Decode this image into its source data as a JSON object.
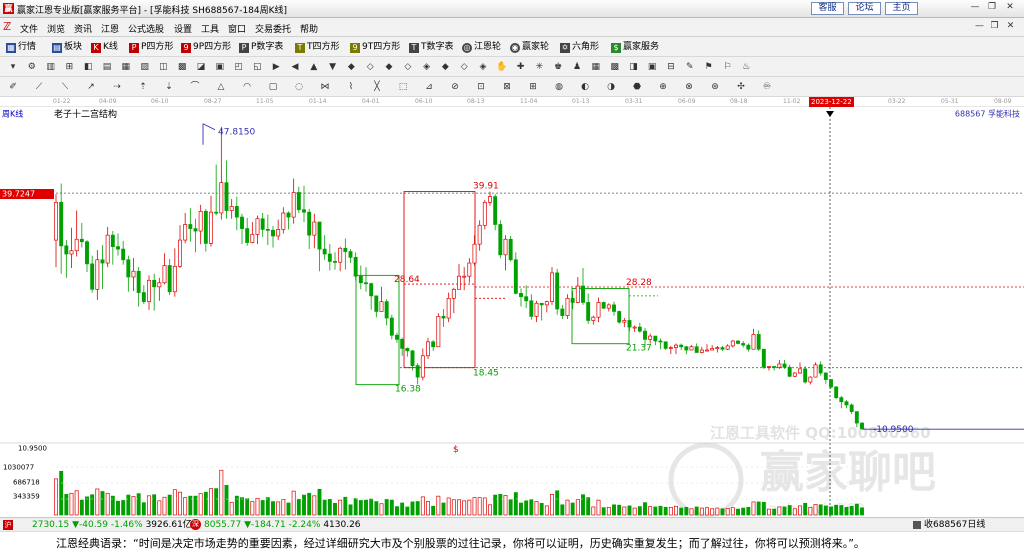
{
  "window": {
    "title": "赢家江恩专业版[赢家服务平台] - [孚能科技  SH688567-184周K线]",
    "links": [
      "客服",
      "论坛",
      "主页"
    ]
  },
  "menu": {
    "items": [
      "文件",
      "浏览",
      "资讯",
      "江恩",
      "公式选股",
      "设置",
      "工具",
      "窗口",
      "交易委托",
      "帮助"
    ]
  },
  "toolbar": {
    "items": [
      {
        "label": "行情",
        "icon": "grid-icon",
        "color": "#2a4d9a"
      },
      {
        "label": "板块",
        "icon": "blocks-icon",
        "color": "#2a4d9a"
      },
      {
        "label": "K线",
        "icon": "candlestick-icon",
        "color": "#c00000"
      },
      {
        "label": "P四方形",
        "icon": "square-p-icon",
        "color": "#c00000"
      },
      {
        "label": "9P四方形",
        "icon": "square-9p-icon",
        "color": "#c00000"
      },
      {
        "label": "P数字表",
        "icon": "table-p-icon",
        "color": "#333333"
      },
      {
        "label": "T四方形",
        "icon": "square-t-icon",
        "color": "#7a7a00"
      },
      {
        "label": "9T四方形",
        "icon": "square-9t-icon",
        "color": "#7a7a00"
      },
      {
        "label": "T数字表",
        "icon": "table-t-icon",
        "color": "#333333"
      },
      {
        "label": "江恩轮",
        "icon": "gann-wheel-icon",
        "color": "#333333"
      },
      {
        "label": "赢家轮",
        "icon": "winner-wheel-icon",
        "color": "#333333"
      },
      {
        "label": "六角形",
        "icon": "hexagon-icon",
        "color": "#333333"
      },
      {
        "label": "赢家服务",
        "icon": "dollar-icon",
        "color": "#2a8a2a"
      }
    ]
  },
  "date_axis": {
    "labels": [
      "01-22",
      "04-09",
      "06-10",
      "08-27",
      "11-05",
      "01-14",
      "04-01",
      "06-10",
      "08-13",
      "11-04",
      "01-13",
      "03-31",
      "06-09",
      "08-18",
      "11-02",
      "03-22",
      "05-31",
      "08-09"
    ],
    "selected": "2023-12-22"
  },
  "chart": {
    "period_label": "周K线",
    "structure_label": "老子十二宫结构",
    "stock_label": "688567 孚能科技",
    "price_tag": "39.7247",
    "annotations": {
      "high": "47.8150",
      "box_top": "39.91",
      "box_mid": "28.64",
      "box_low": "18.45",
      "left_low": "16.38",
      "right_mid": "28.28",
      "right_low": "21.37",
      "last_low": "-10.9500",
      "marker": "$"
    },
    "watermark": {
      "line1": "江恩工具软件  QQ:100800360",
      "line2": "赢家聊吧",
      "line3": "liaoba.win360"
    },
    "colors": {
      "up": "#e00000",
      "down": "#00a000",
      "box_red": "#e00000",
      "box_green": "#00a000",
      "blue": "#3030b0"
    }
  },
  "volume": {
    "labels": [
      "10.9500",
      "1030077",
      "686718",
      "343359"
    ]
  },
  "chart_data": {
    "type": "candlestick",
    "title": "老子十二宫结构",
    "series_name": "688567 孚能科技 周K线",
    "ylim": [
      10,
      49
    ],
    "key_levels": [
      47.815,
      39.91,
      39.7247,
      28.64,
      28.28,
      21.37,
      18.45,
      16.38,
      10.95
    ],
    "candles": [
      [
        34.0,
        38.6,
        39.6,
        30.7
      ],
      [
        38.6,
        33.3,
        40.9,
        29.9
      ],
      [
        33.3,
        32.3,
        34.0,
        29.4
      ],
      [
        32.3,
        32.7,
        35.5,
        30.6
      ],
      [
        32.7,
        34.1,
        37.6,
        32.0
      ],
      [
        34.1,
        33.8,
        36.1,
        33.1
      ],
      [
        33.8,
        31.1,
        34.0,
        30.1
      ],
      [
        31.1,
        28.0,
        32.1,
        27.6
      ],
      [
        28.0,
        31.6,
        32.8,
        26.7
      ],
      [
        31.6,
        31.2,
        33.4,
        28.0
      ],
      [
        31.2,
        34.6,
        35.6,
        30.7
      ],
      [
        34.6,
        33.2,
        35.1,
        31.0
      ],
      [
        33.2,
        32.9,
        34.8,
        32.1
      ],
      [
        32.9,
        31.6,
        33.9,
        31.0
      ],
      [
        31.6,
        29.5,
        32.1,
        27.7
      ],
      [
        29.5,
        30.2,
        31.8,
        27.8
      ],
      [
        30.2,
        27.6,
        30.7,
        25.9
      ],
      [
        27.6,
        26.5,
        28.5,
        26.2
      ],
      [
        26.5,
        29.1,
        29.7,
        25.5
      ],
      [
        29.1,
        28.3,
        29.9,
        25.4
      ],
      [
        28.3,
        28.8,
        29.4,
        26.6
      ],
      [
        28.8,
        30.9,
        32.4,
        28.6
      ],
      [
        30.9,
        27.7,
        31.7,
        27.3
      ],
      [
        27.7,
        30.8,
        33.0,
        27.1
      ],
      [
        30.8,
        34.0,
        35.8,
        30.6
      ],
      [
        34.0,
        35.9,
        37.3,
        33.6
      ],
      [
        35.9,
        35.4,
        37.9,
        33.8
      ],
      [
        35.4,
        35.1,
        36.6,
        32.5
      ],
      [
        35.1,
        37.5,
        38.3,
        33.5
      ],
      [
        37.5,
        33.6,
        37.8,
        32.6
      ],
      [
        33.6,
        37.4,
        39.4,
        33.2
      ],
      [
        37.4,
        37.3,
        43.2,
        37.0
      ],
      [
        37.3,
        41.0,
        47.8,
        36.5
      ],
      [
        41.0,
        37.6,
        43.7,
        36.6
      ],
      [
        37.6,
        38.1,
        39.0,
        36.6
      ],
      [
        38.1,
        36.8,
        39.3,
        35.2
      ],
      [
        36.8,
        35.4,
        37.2,
        33.5
      ],
      [
        35.4,
        33.7,
        36.7,
        33.3
      ],
      [
        33.7,
        34.7,
        36.2,
        33.6
      ],
      [
        34.7,
        36.6,
        37.0,
        33.5
      ],
      [
        36.6,
        35.3,
        37.3,
        34.4
      ],
      [
        35.3,
        35.2,
        37.1,
        33.4
      ],
      [
        35.2,
        34.5,
        35.7,
        33.1
      ],
      [
        34.5,
        35.3,
        36.5,
        34.0
      ],
      [
        35.3,
        37.3,
        38.0,
        34.8
      ],
      [
        37.3,
        36.8,
        37.5,
        35.3
      ],
      [
        36.8,
        39.8,
        41.5,
        36.0
      ],
      [
        39.8,
        37.7,
        40.5,
        37.3
      ],
      [
        37.7,
        37.4,
        40.6,
        36.2
      ],
      [
        37.4,
        34.6,
        37.8,
        32.9
      ],
      [
        34.6,
        36.2,
        37.2,
        33.0
      ],
      [
        36.2,
        32.9,
        36.2,
        30.2
      ],
      [
        32.9,
        32.3,
        34.6,
        31.6
      ],
      [
        32.3,
        31.4,
        33.5,
        30.3
      ],
      [
        31.4,
        31.3,
        32.5,
        30.4
      ],
      [
        31.3,
        33.0,
        33.2,
        30.2
      ],
      [
        33.0,
        32.6,
        34.2,
        30.4
      ],
      [
        32.6,
        31.9,
        32.9,
        31.2
      ],
      [
        31.9,
        29.6,
        32.5,
        29.1
      ],
      [
        29.6,
        28.8,
        30.9,
        28.0
      ],
      [
        28.8,
        28.7,
        30.7,
        27.7
      ],
      [
        28.7,
        27.2,
        28.8,
        25.5
      ],
      [
        27.2,
        25.3,
        27.2,
        24.6
      ],
      [
        25.3,
        26.5,
        28.3,
        26.3
      ],
      [
        26.5,
        24.5,
        26.8,
        23.6
      ],
      [
        24.5,
        22.4,
        24.9,
        21.9
      ],
      [
        22.4,
        21.9,
        22.7,
        21.5
      ],
      [
        21.9,
        20.8,
        22.1,
        19.9
      ],
      [
        20.8,
        20.5,
        20.9,
        19.8
      ],
      [
        20.5,
        18.7,
        20.6,
        18.1
      ],
      [
        18.7,
        17.3,
        19.0,
        16.4
      ],
      [
        17.3,
        19.9,
        20.8,
        16.9
      ],
      [
        19.9,
        21.6,
        22.1,
        19.5
      ],
      [
        21.6,
        21.0,
        21.8,
        20.5
      ],
      [
        21.0,
        24.7,
        25.1,
        21.0
      ],
      [
        24.7,
        24.5,
        25.6,
        23.4
      ],
      [
        24.5,
        26.9,
        27.6,
        24.0
      ],
      [
        26.9,
        28.0,
        28.2,
        25.1
      ],
      [
        28.0,
        29.6,
        31.1,
        28.0
      ],
      [
        29.6,
        29.6,
        30.7,
        27.9
      ],
      [
        29.6,
        31.2,
        31.8,
        28.8
      ],
      [
        31.2,
        33.5,
        34.6,
        30.9
      ],
      [
        33.5,
        35.8,
        36.4,
        32.7
      ],
      [
        35.8,
        38.6,
        38.9,
        35.3
      ],
      [
        38.6,
        39.3,
        39.9,
        38.2
      ],
      [
        39.3,
        35.9,
        39.6,
        35.2
      ],
      [
        35.9,
        32.2,
        36.4,
        31.8
      ],
      [
        32.2,
        34.1,
        34.6,
        30.3
      ],
      [
        34.1,
        31.6,
        34.5,
        31.4
      ],
      [
        31.6,
        27.5,
        32.5,
        27.4
      ],
      [
        27.5,
        27.1,
        28.1,
        25.9
      ],
      [
        27.1,
        26.6,
        28.5,
        25.7
      ],
      [
        26.6,
        24.7,
        27.4,
        24.3
      ],
      [
        24.7,
        26.3,
        26.6,
        24.0
      ],
      [
        26.3,
        26.1,
        26.3,
        24.2
      ],
      [
        26.1,
        26.5,
        26.6,
        25.2
      ],
      [
        26.5,
        30.0,
        30.7,
        26.1
      ],
      [
        30.0,
        25.6,
        30.5,
        24.9
      ],
      [
        25.6,
        24.8,
        26.1,
        24.4
      ],
      [
        24.8,
        26.9,
        27.4,
        24.4
      ],
      [
        26.9,
        26.4,
        27.8,
        25.6
      ],
      [
        26.4,
        28.4,
        29.5,
        26.3
      ],
      [
        28.4,
        26.4,
        30.6,
        26.1
      ],
      [
        26.4,
        24.2,
        27.5,
        23.8
      ],
      [
        24.2,
        24.6,
        24.8,
        23.7
      ],
      [
        24.6,
        26.4,
        27.0,
        24.0
      ],
      [
        26.4,
        25.7,
        26.5,
        25.6
      ],
      [
        25.7,
        26.1,
        26.3,
        25.3
      ],
      [
        26.1,
        25.3,
        26.5,
        24.8
      ],
      [
        25.3,
        24.0,
        25.4,
        23.8
      ],
      [
        24.0,
        24.2,
        24.5,
        23.4
      ],
      [
        24.2,
        23.4,
        24.3,
        22.9
      ],
      [
        23.4,
        23.4,
        23.6,
        22.8
      ],
      [
        23.4,
        22.9,
        23.9,
        22.7
      ],
      [
        22.9,
        21.9,
        23.3,
        21.0
      ],
      [
        21.9,
        22.3,
        22.6,
        21.4
      ],
      [
        22.3,
        21.7,
        22.3,
        21.2
      ],
      [
        21.7,
        21.6,
        22.0,
        20.7
      ],
      [
        21.6,
        20.8,
        21.6,
        20.6
      ],
      [
        20.8,
        20.9,
        21.1,
        20.1
      ],
      [
        20.9,
        21.2,
        21.4,
        20.1
      ],
      [
        21.2,
        21.0,
        21.4,
        20.6
      ],
      [
        21.0,
        20.6,
        21.1,
        20.1
      ],
      [
        20.6,
        21.0,
        21.2,
        20.6
      ],
      [
        21.0,
        20.3,
        21.4,
        20.3
      ],
      [
        20.3,
        20.6,
        21.0,
        20.2
      ],
      [
        20.6,
        20.6,
        21.3,
        20.4
      ],
      [
        20.6,
        20.8,
        21.2,
        20.6
      ],
      [
        20.8,
        20.9,
        21.1,
        20.3
      ],
      [
        20.9,
        20.7,
        21.1,
        20.5
      ],
      [
        20.7,
        21.1,
        21.3,
        20.6
      ],
      [
        21.1,
        21.7,
        21.8,
        20.9
      ],
      [
        21.7,
        21.4,
        21.8,
        21.3
      ],
      [
        21.4,
        21.2,
        21.7,
        20.9
      ],
      [
        21.2,
        20.7,
        21.4,
        20.4
      ],
      [
        20.7,
        22.5,
        23.2,
        20.7
      ],
      [
        22.5,
        20.7,
        23.0,
        20.5
      ],
      [
        20.7,
        18.5,
        20.7,
        18.3
      ],
      [
        18.5,
        18.6,
        18.6,
        18.1
      ],
      [
        18.6,
        18.5,
        18.6,
        18.1
      ],
      [
        18.5,
        18.9,
        19.4,
        18.3
      ],
      [
        18.9,
        18.5,
        19.4,
        18.3
      ],
      [
        18.5,
        17.4,
        18.8,
        17.3
      ],
      [
        17.4,
        17.8,
        17.9,
        17.3
      ],
      [
        17.8,
        18.3,
        19.1,
        17.7
      ],
      [
        18.3,
        16.7,
        18.6,
        16.5
      ],
      [
        16.7,
        17.3,
        17.4,
        16.4
      ],
      [
        17.3,
        18.8,
        19.1,
        17.3
      ],
      [
        18.8,
        17.8,
        19.2,
        17.5
      ],
      [
        17.8,
        17.0,
        17.9,
        16.5
      ],
      [
        17.0,
        16.1,
        17.0,
        15.9
      ],
      [
        16.1,
        14.8,
        16.2,
        14.6
      ],
      [
        14.8,
        14.3,
        15.0,
        13.5
      ],
      [
        14.3,
        13.9,
        14.5,
        13.5
      ],
      [
        13.9,
        13.1,
        14.1,
        12.8
      ],
      [
        13.1,
        11.7,
        13.1,
        11.2
      ],
      [
        11.7,
        11.0,
        11.8,
        10.95
      ]
    ],
    "volume_ylim": [
      0,
      1030077
    ]
  }
}
